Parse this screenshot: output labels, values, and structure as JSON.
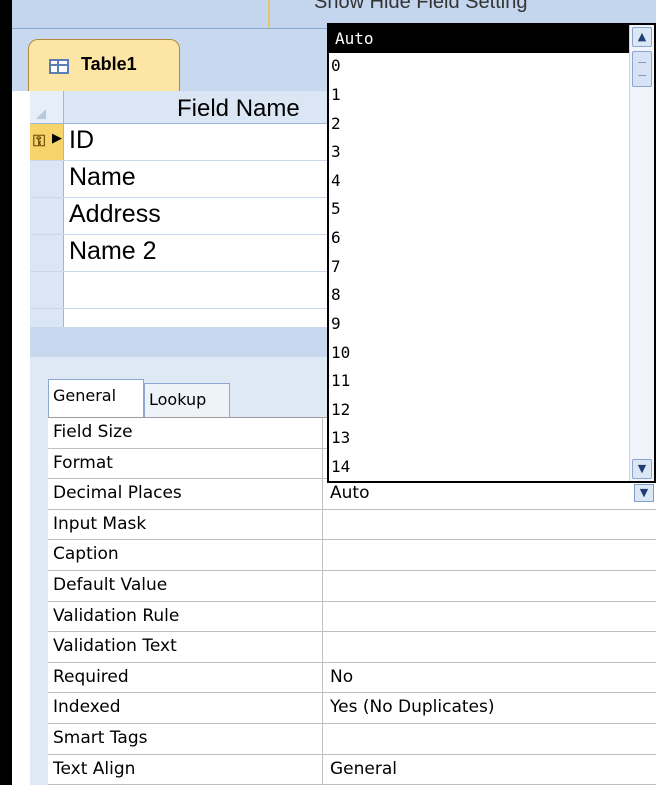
{
  "window": {
    "top_header_text": "Show Hide    Field Setting"
  },
  "document_tab": {
    "label": "Table1",
    "icon": "table-icon"
  },
  "field_grid": {
    "column_header": "Field Name",
    "rows": [
      {
        "name": "ID",
        "primary_key": true
      },
      {
        "name": "Name"
      },
      {
        "name": "Address"
      },
      {
        "name": "Name 2"
      },
      {
        "name": ""
      },
      {
        "name": ""
      }
    ]
  },
  "property_tabs": {
    "general": "General",
    "lookup": "Lookup"
  },
  "properties": [
    {
      "name": "Field Size",
      "value": ""
    },
    {
      "name": "Format",
      "value": ""
    },
    {
      "name": "Decimal Places",
      "value": "Auto",
      "has_dropdown": true
    },
    {
      "name": "Input Mask",
      "value": ""
    },
    {
      "name": "Caption",
      "value": ""
    },
    {
      "name": "Default Value",
      "value": ""
    },
    {
      "name": "Validation Rule",
      "value": ""
    },
    {
      "name": "Validation Text",
      "value": ""
    },
    {
      "name": "Required",
      "value": "No"
    },
    {
      "name": "Indexed",
      "value": "Yes (No Duplicates)"
    },
    {
      "name": "Smart Tags",
      "value": ""
    },
    {
      "name": "Text Align",
      "value": "General"
    }
  ],
  "decimal_dropdown": {
    "selected": "Auto",
    "options": [
      "Auto",
      "0",
      "1",
      "2",
      "3",
      "4",
      "5",
      "6",
      "7",
      "8",
      "9",
      "10",
      "11",
      "12",
      "13",
      "14"
    ]
  },
  "colors": {
    "ribbon_blue": "#c4d6ee",
    "tab_gold": "#fde5a6",
    "selection_black": "#000000"
  }
}
